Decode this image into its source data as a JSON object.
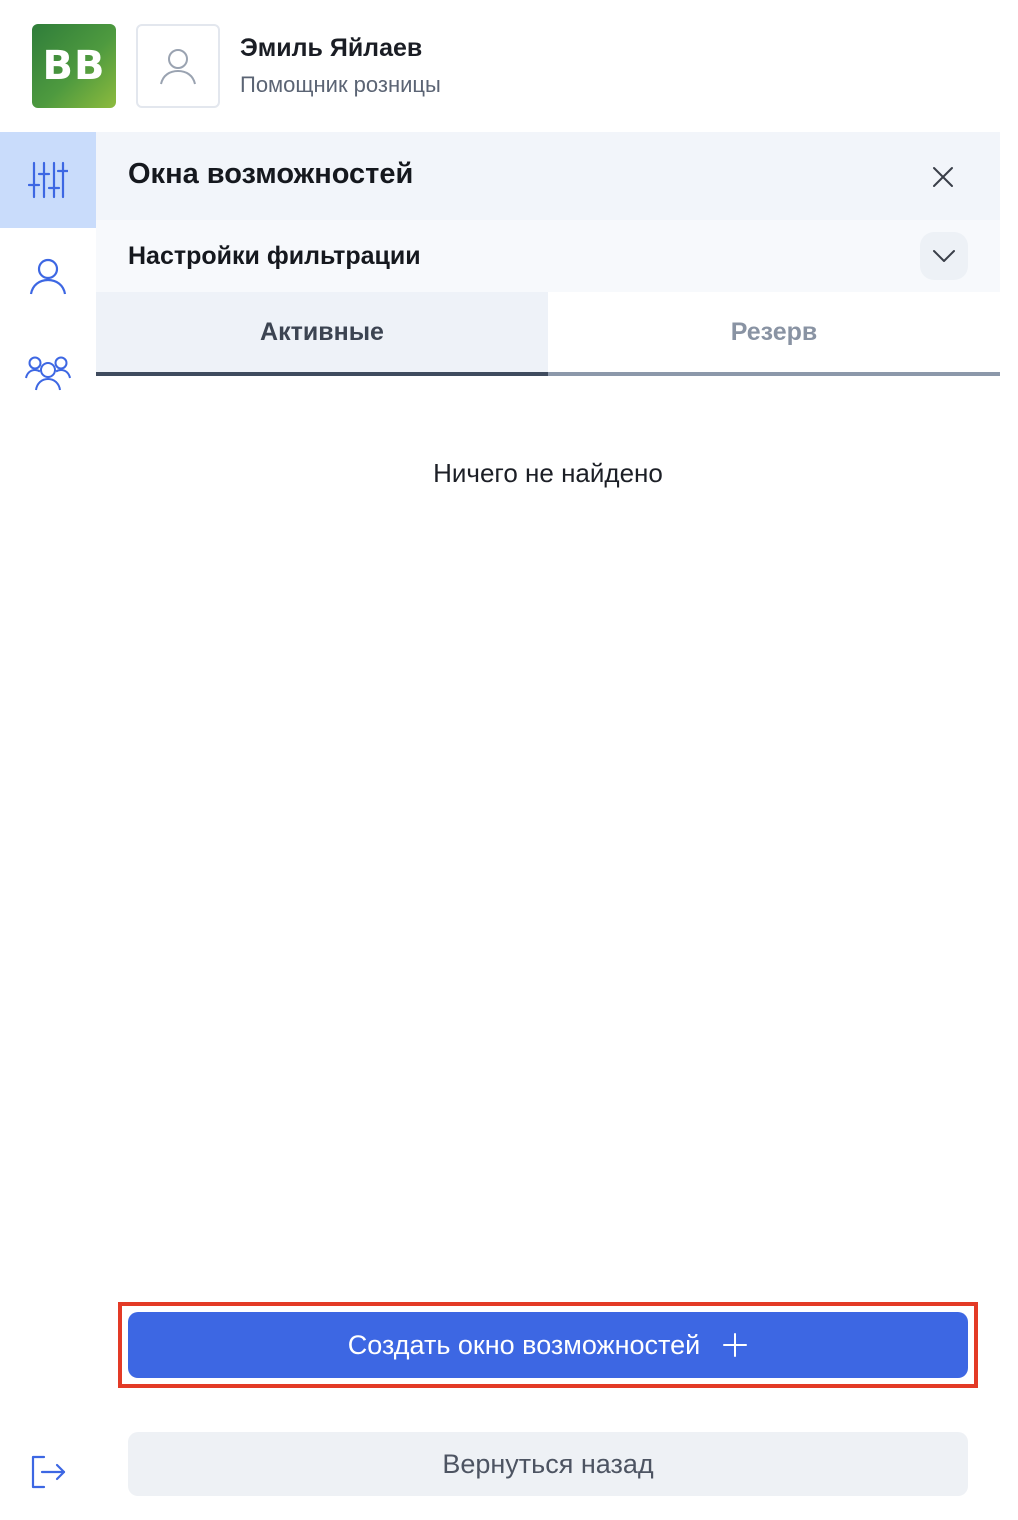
{
  "header": {
    "logo_text": "BB",
    "user_name": "Эмиль Яйлаев",
    "user_role": "Помощник розницы"
  },
  "rail": {
    "items": [
      {
        "icon": "sliders-icon",
        "active": true
      },
      {
        "icon": "user-icon",
        "active": false
      },
      {
        "icon": "users-group-icon",
        "active": false
      }
    ],
    "exit_icon": "logout-icon"
  },
  "panel": {
    "title": "Окна возможностей",
    "filter_title": "Настройки фильтрации",
    "tabs": [
      {
        "label": "Активные",
        "active": true
      },
      {
        "label": "Резерв",
        "active": false
      }
    ],
    "empty_text": "Ничего не найдено",
    "create_label": "Создать окно возможностей"
  },
  "footer": {
    "back_label": "Вернуться назад"
  },
  "colors": {
    "accent": "#3d67e3",
    "active_rail": "#c9dcfb",
    "highlight": "#e33a26"
  }
}
